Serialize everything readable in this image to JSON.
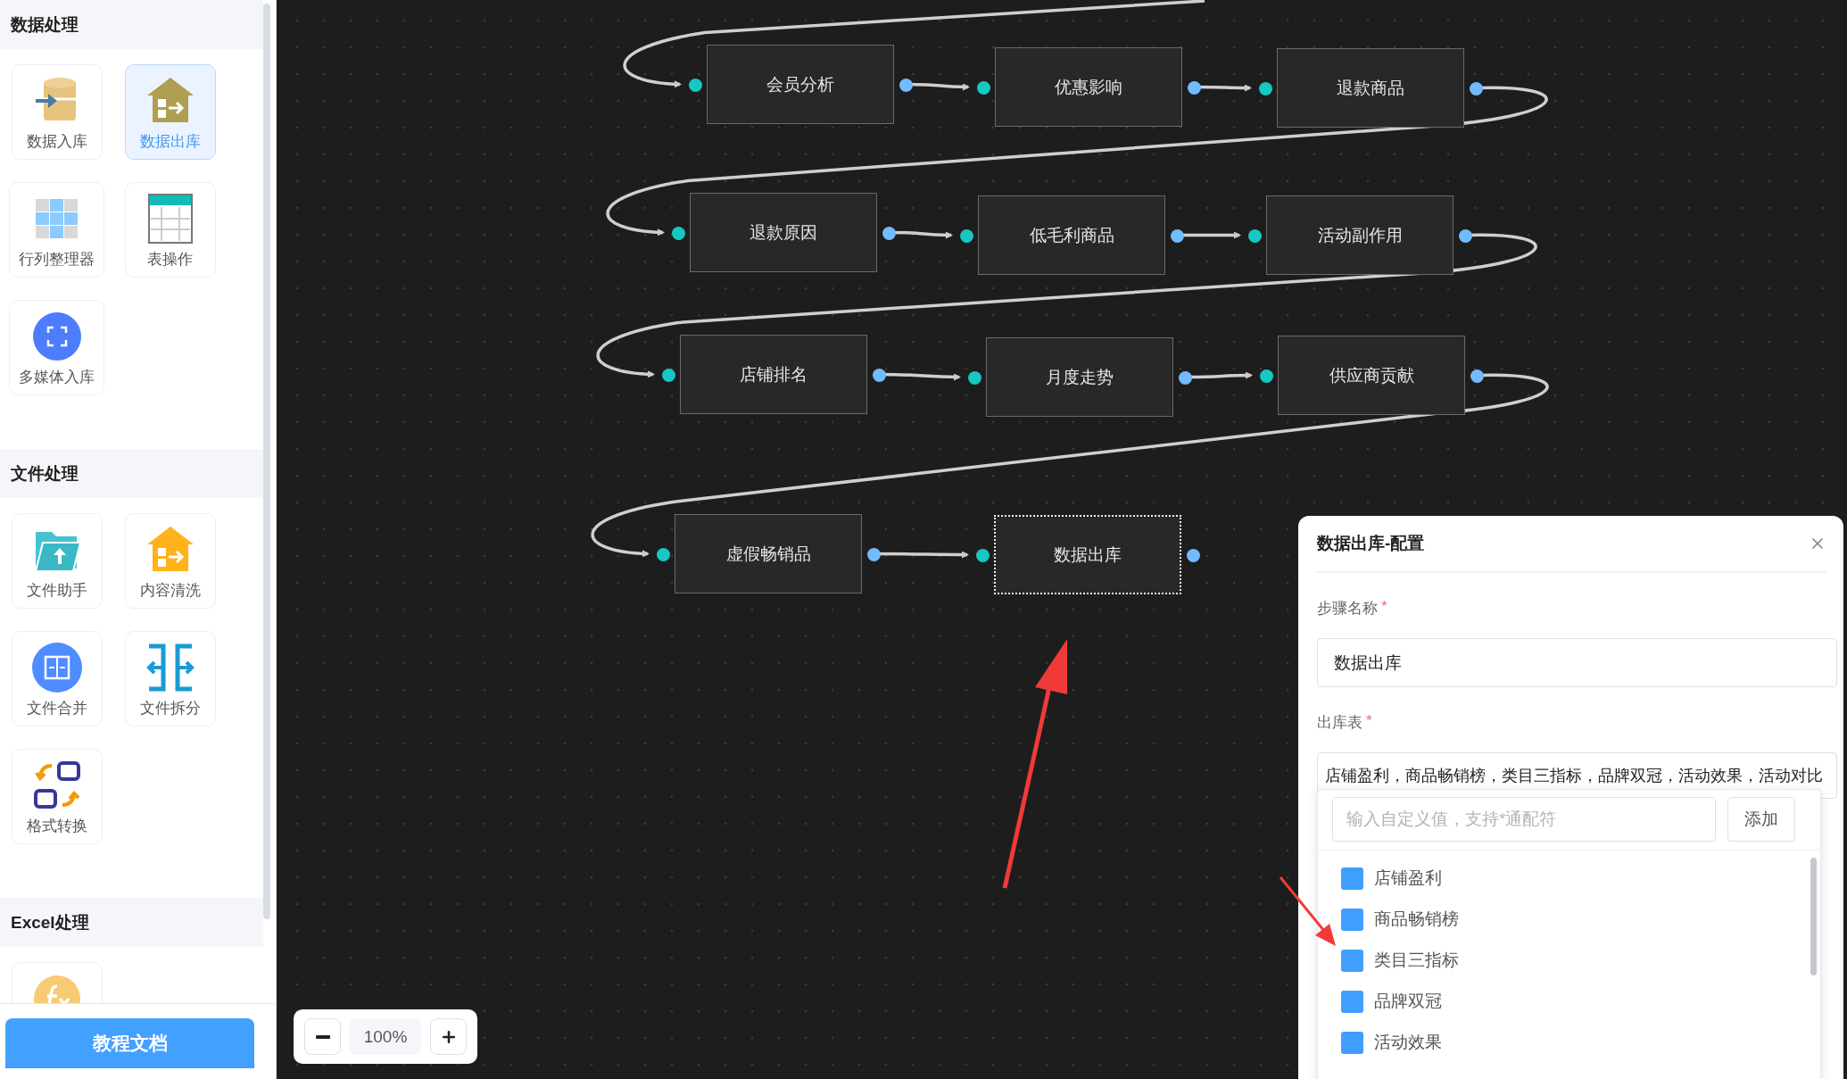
{
  "sidebar": {
    "groups": [
      {
        "title": "数据处理",
        "items": [
          {
            "label": "数据入库",
            "kind": "db-import",
            "selected": false
          },
          {
            "label": "数据出库",
            "kind": "house-export",
            "selected": true
          },
          {
            "label": "行列整理器",
            "kind": "grid",
            "selected": false
          },
          {
            "label": "表操作",
            "kind": "table",
            "selected": false
          },
          {
            "label": "多媒体入库",
            "kind": "scan",
            "selected": false
          }
        ]
      },
      {
        "title": "文件处理",
        "items": [
          {
            "label": "文件助手",
            "kind": "folder",
            "selected": false
          },
          {
            "label": "内容清洗",
            "kind": "house-clean",
            "selected": false
          },
          {
            "label": "文件合并",
            "kind": "merge",
            "selected": false
          },
          {
            "label": "文件拆分",
            "kind": "split",
            "selected": false
          },
          {
            "label": "格式转换",
            "kind": "convert",
            "selected": false
          }
        ]
      },
      {
        "title": "Excel处理",
        "items": [
          {
            "kind": "formula",
            "selected": false
          }
        ]
      }
    ],
    "footer_button": "教程文档"
  },
  "canvas": {
    "nodes": [
      {
        "label": "会员分析",
        "selected": false
      },
      {
        "label": "优惠影响",
        "selected": false
      },
      {
        "label": "退款商品",
        "selected": false
      },
      {
        "label": "退款原因",
        "selected": false
      },
      {
        "label": "低毛利商品",
        "selected": false
      },
      {
        "label": "活动副作用",
        "selected": false
      },
      {
        "label": "店铺排名",
        "selected": false
      },
      {
        "label": "月度走势",
        "selected": false
      },
      {
        "label": "供应商贡献",
        "selected": false
      },
      {
        "label": "虚假畅销品",
        "selected": false
      },
      {
        "label": "数据出库",
        "selected": true
      }
    ],
    "zoom": "100%"
  },
  "config_panel": {
    "title": "数据出库-配置",
    "fields": [
      {
        "label": "步骤名称",
        "required_mark": "*",
        "value": "数据出库"
      },
      {
        "label": "出库表",
        "required_mark": "*",
        "value": "店铺盈利，商品畅销榜，类目三指标，品牌双冠，活动效果，活动对比"
      }
    ],
    "dropdown": {
      "placeholder": "输入自定义值，支持*通配符",
      "add_button": "添加",
      "options": [
        {
          "label": "店铺盈利",
          "checked": true
        },
        {
          "label": "商品畅销榜",
          "checked": true
        },
        {
          "label": "类目三指标",
          "checked": true
        },
        {
          "label": "品牌双冠",
          "checked": true
        },
        {
          "label": "活动效果",
          "checked": true
        }
      ]
    }
  }
}
